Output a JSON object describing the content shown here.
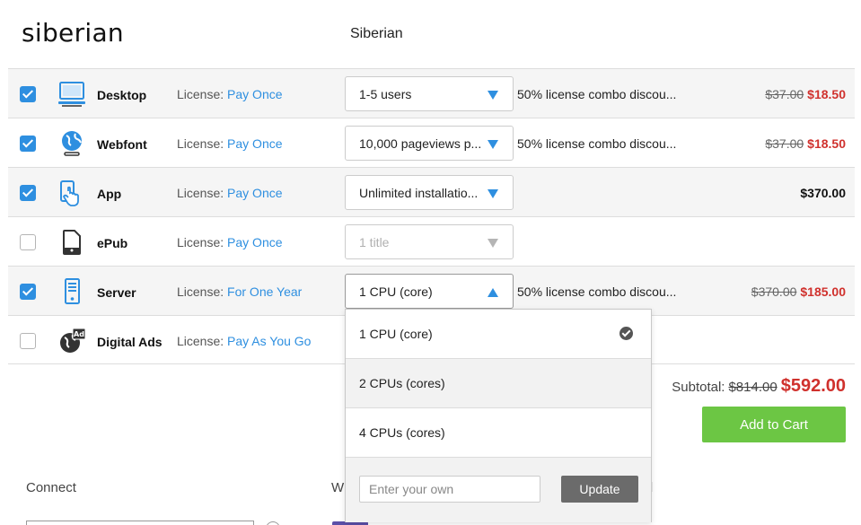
{
  "header": {
    "logo": "siberian",
    "font_name": "Siberian"
  },
  "products": [
    {
      "name": "Desktop",
      "checked": true,
      "icon": "desktop-icon",
      "license_label": "License:",
      "license_value": "Pay Once",
      "select_value": "1-5 users",
      "discount": "50% license combo discou...",
      "old_price": "$37.00",
      "new_price": "$18.50"
    },
    {
      "name": "Webfont",
      "checked": true,
      "icon": "webfont-globe-icon",
      "license_label": "License:",
      "license_value": "Pay Once",
      "select_value": "10,000 pageviews p...",
      "discount": "50% license combo discou...",
      "old_price": "$37.00",
      "new_price": "$18.50"
    },
    {
      "name": "App",
      "checked": true,
      "icon": "app-touch-icon",
      "license_label": "License:",
      "license_value": "Pay Once",
      "select_value": "Unlimited installatio...",
      "discount": "",
      "price": "$370.00"
    },
    {
      "name": "ePub",
      "checked": false,
      "icon": "epub-device-icon",
      "license_label": "License:",
      "license_value": "Pay Once",
      "select_value": "1 title",
      "discount": ""
    },
    {
      "name": "Server",
      "checked": true,
      "icon": "server-icon",
      "license_label": "License:",
      "license_value": "For One Year",
      "select_value": "1 CPU (core)",
      "discount": "50% license combo discou...",
      "old_price": "$370.00",
      "new_price": "$185.00"
    },
    {
      "name": "Digital Ads",
      "checked": false,
      "icon": "digital-ads-icon",
      "license_label": "License:",
      "license_value": "Pay As You Go",
      "ad_badge": "Ad"
    }
  ],
  "dropdown": {
    "options": [
      "1 CPU (core)",
      "2 CPUs (cores)",
      "4 CPUs (cores)"
    ],
    "selected_index": 0,
    "custom_placeholder": "Enter your own",
    "update_label": "Update"
  },
  "totals": {
    "label": "Subtotal:",
    "old": "$814.00",
    "new": "$592.00",
    "cart_label": "Add to Cart"
  },
  "footer": {
    "connect": "Connect",
    "w_text": "W",
    "partial": "l"
  },
  "colors": {
    "accent": "#2e8fe0",
    "sale": "#d0312d",
    "cart": "#6cc644"
  }
}
